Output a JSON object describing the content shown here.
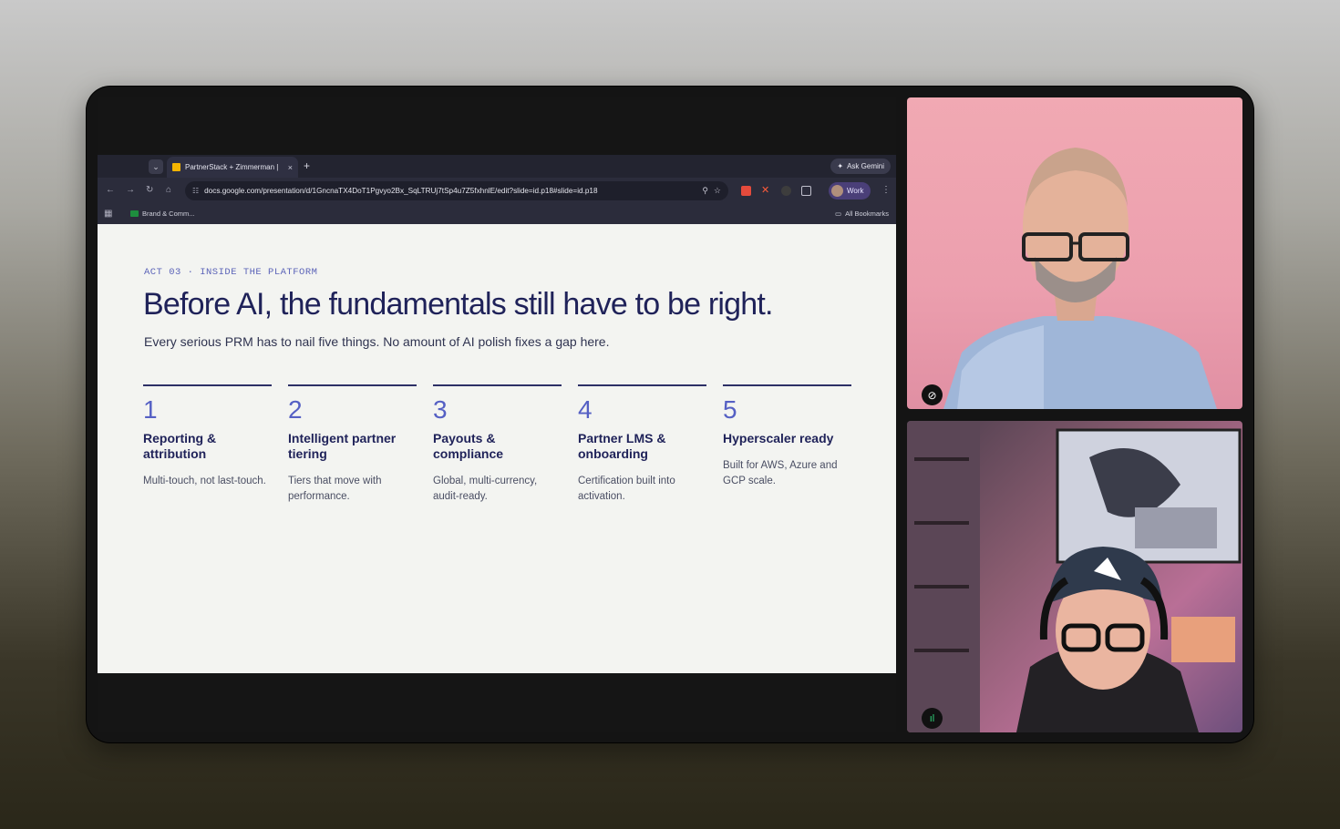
{
  "browser": {
    "tab_title": "PartnerStack + Zimmerman |",
    "tab_close": "×",
    "new_tab": "+",
    "ask_gemini": "Ask Gemini",
    "url": "docs.google.com/presentation/d/1GncnaTX4DoT1Pgvyo2Bx_SqLTRUj7tSp4u7Z5fxhnlE/edit?slide=id.p18#slide=id.p18",
    "profile_label": "Work",
    "bookmark_item": "Brand & Comm...",
    "all_bookmarks": "All Bookmarks"
  },
  "slide": {
    "eyebrow": "ACT 03 · INSIDE THE PLATFORM",
    "headline": "Before AI, the fundamentals still have to be right.",
    "subtitle": "Every serious PRM has to nail five things. No amount of AI polish fixes a gap here.",
    "columns": [
      {
        "num": "1",
        "title": "Reporting & attribution",
        "desc": "Multi-touch, not last-touch."
      },
      {
        "num": "2",
        "title": "Intelligent partner tiering",
        "desc": "Tiers that move with performance."
      },
      {
        "num": "3",
        "title": "Payouts & compliance",
        "desc": "Global, multi-currency, audit-ready."
      },
      {
        "num": "4",
        "title": "Partner LMS & onboarding",
        "desc": "Certification built into activation."
      },
      {
        "num": "5",
        "title": "Hyperscaler ready",
        "desc": "Built for AWS, Azure and GCP scale."
      }
    ]
  },
  "participants": [
    {
      "icon": "mic-off-icon",
      "state": "muted"
    },
    {
      "icon": "speaking-indicator-icon",
      "state": "speaking"
    }
  ],
  "colors": {
    "accent": "#5560c4",
    "headline": "#1f2259",
    "slide_bg": "#f3f4f1"
  }
}
